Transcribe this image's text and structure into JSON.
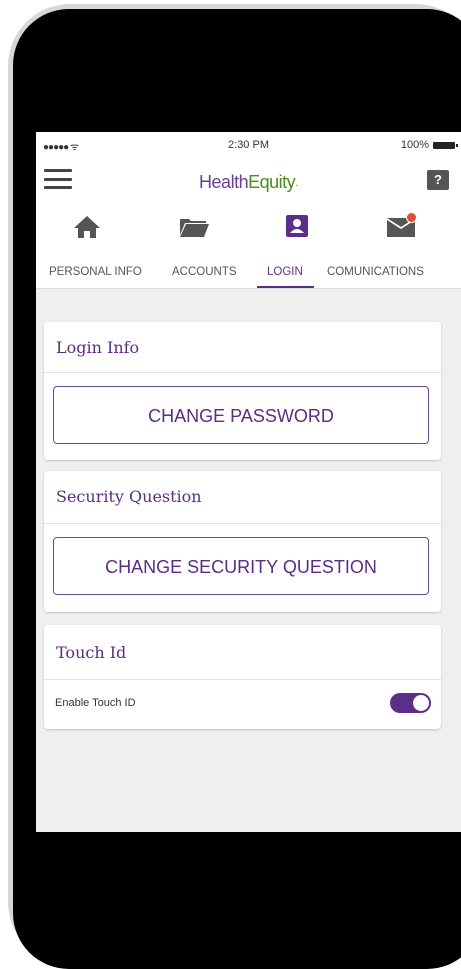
{
  "status_bar": {
    "signal": "●●●●●",
    "time": "2:30 PM",
    "battery": "100%"
  },
  "header": {
    "logo_health": "Health",
    "logo_equity": "Equity",
    "logo_tm": "·",
    "help": "?"
  },
  "icon_nav": [
    "home-icon",
    "folder-icon",
    "user-badge-icon",
    "mail-icon"
  ],
  "tabs": [
    {
      "label": "PERSONAL INFO"
    },
    {
      "label": "ACCOUNTS"
    },
    {
      "label": "LOGIN"
    },
    {
      "label": "COMUNICATIONS"
    }
  ],
  "active_tab": "LOGIN",
  "login_info": {
    "title": "Login Info",
    "button": "CHANGE PASSWORD"
  },
  "security_question": {
    "title": "Security Question",
    "button": "CHANGE SECURITY QUESTION"
  },
  "touch_id": {
    "title": "Touch Id",
    "label": "Enable Touch ID",
    "enabled": true
  },
  "colors": {
    "brand_purple": "#5c2e8a",
    "brand_green": "#4f8a1f",
    "badge_red": "#e04e3c"
  }
}
